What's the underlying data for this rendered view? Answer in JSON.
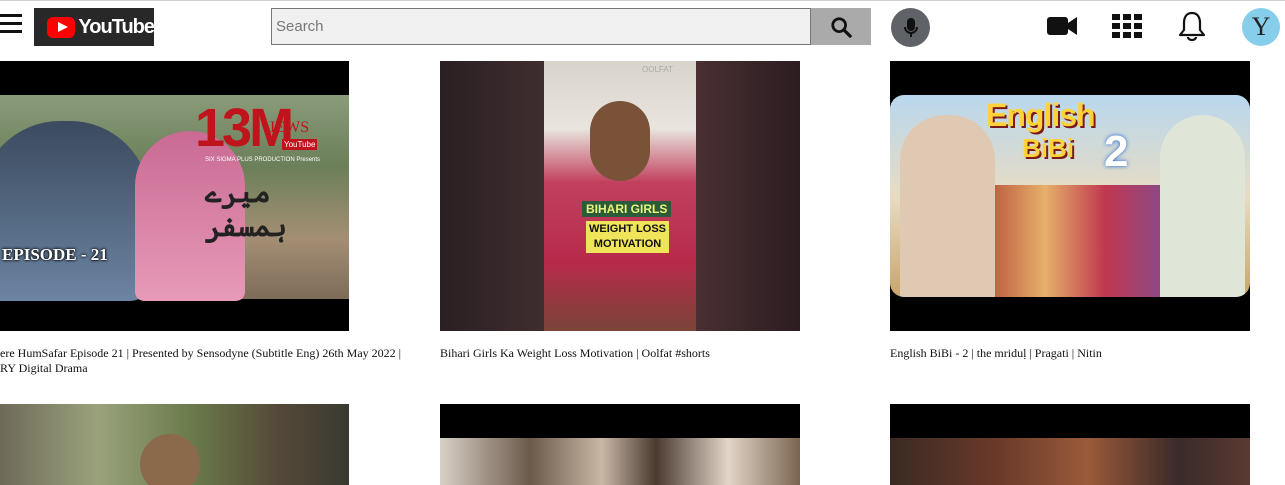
{
  "header": {
    "logo_text": "YouTube",
    "search_placeholder": "Search",
    "search_value": "",
    "avatar_letter": "Y"
  },
  "colors": {
    "logo_bg": "#282828",
    "youtube_red": "#ff0000",
    "search_button_bg": "#aaaaaa",
    "mic_bg": "#5f6368",
    "avatar_bg": "#87ceeb"
  },
  "icons": [
    "menu-icon",
    "search-icon",
    "microphone-icon",
    "video-camera-icon",
    "apps-grid-icon",
    "bell-icon"
  ],
  "videos": [
    {
      "title": "ere HumSafar Episode 21 | Presented by Sensodyne (Subtitle Eng) 26th May 2022 | RY Digital Drama",
      "thumb_text": {
        "big_number": "13M",
        "views_word": "IEWS",
        "badge": "YouTube",
        "production": "SIX SIGMA PLUS PRODUCTION Presents",
        "urdu_title": "میرے ہمسفر",
        "episode": "EPISODE - 21"
      }
    },
    {
      "title": "Bihari Girls Ka Weight Loss Motivation | Oolfat #shorts",
      "thumb_text": {
        "channel": "OOLFAT",
        "line1": "BIHARI GIRLS",
        "line2": "WEIGHT LOSS",
        "line3": "MOTIVATION"
      }
    },
    {
      "title": "English BiBi - 2 | the mriduḷ | Pragati | Nitin",
      "thumb_text": {
        "line1": "English",
        "line2": "BiBi",
        "number": "2"
      }
    }
  ]
}
